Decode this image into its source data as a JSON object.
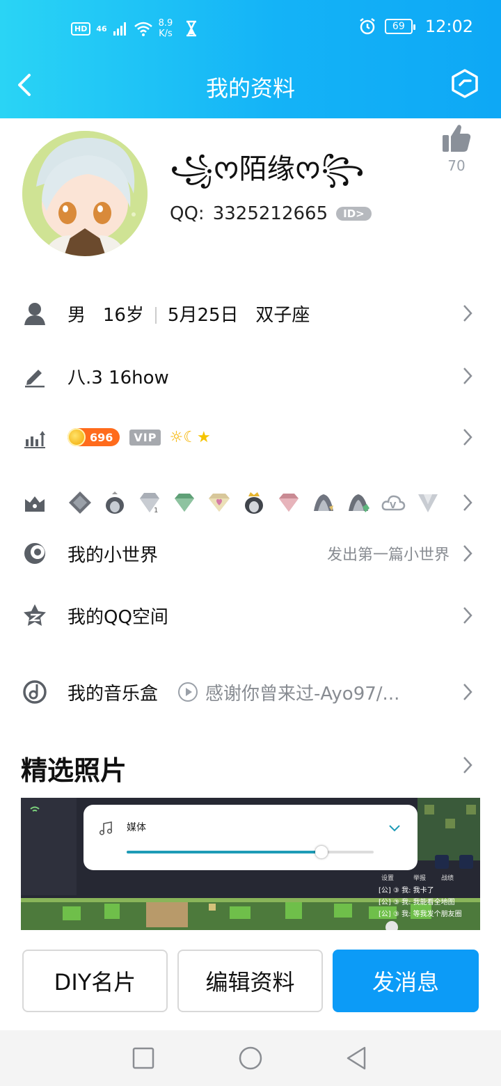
{
  "status_bar": {
    "network_badge": "HD",
    "signal": "46",
    "speed_value": "8.9",
    "speed_unit": "K/s",
    "battery": "69",
    "time": "12:02"
  },
  "nav": {
    "title": "我的资料"
  },
  "profile": {
    "nickname": "꧁ᰔ陌缘ᰔ꧂",
    "qq_label": "QQ:",
    "qq_number": "3325212665",
    "id_badge": "ID>",
    "likes": "70"
  },
  "rows": {
    "info": {
      "gender": "男",
      "age": "16岁",
      "birthday": "5月25日",
      "zodiac": "双子座"
    },
    "signature": {
      "text": "八.3   16how"
    },
    "level": {
      "coin_value": "696",
      "vip_label": "VIP"
    },
    "world": {
      "label": "我的小世界",
      "sub": "发出第一篇小世界"
    },
    "qzone": {
      "label": "我的QQ空间"
    },
    "music": {
      "label": "我的音乐盒",
      "song": "感谢你曾来过-Ayo97/..."
    }
  },
  "photos": {
    "title": "精选照片",
    "volume_label": "媒体",
    "volume_level": 0.79,
    "game_menu": [
      "设置",
      "举报",
      "战绩"
    ],
    "chat": [
      "[公] ③ 我: 我卡了",
      "[公] ③ 我: 我能看全地图",
      "[公] ③ 我: 等我发个朋友圈"
    ]
  },
  "buttons": {
    "diy": "DIY名片",
    "edit": "编辑资料",
    "message": "发消息"
  },
  "colors": {
    "header_start": "#2ad4f5",
    "header_end": "#0ea8f5",
    "primary": "#0c9bf7"
  }
}
